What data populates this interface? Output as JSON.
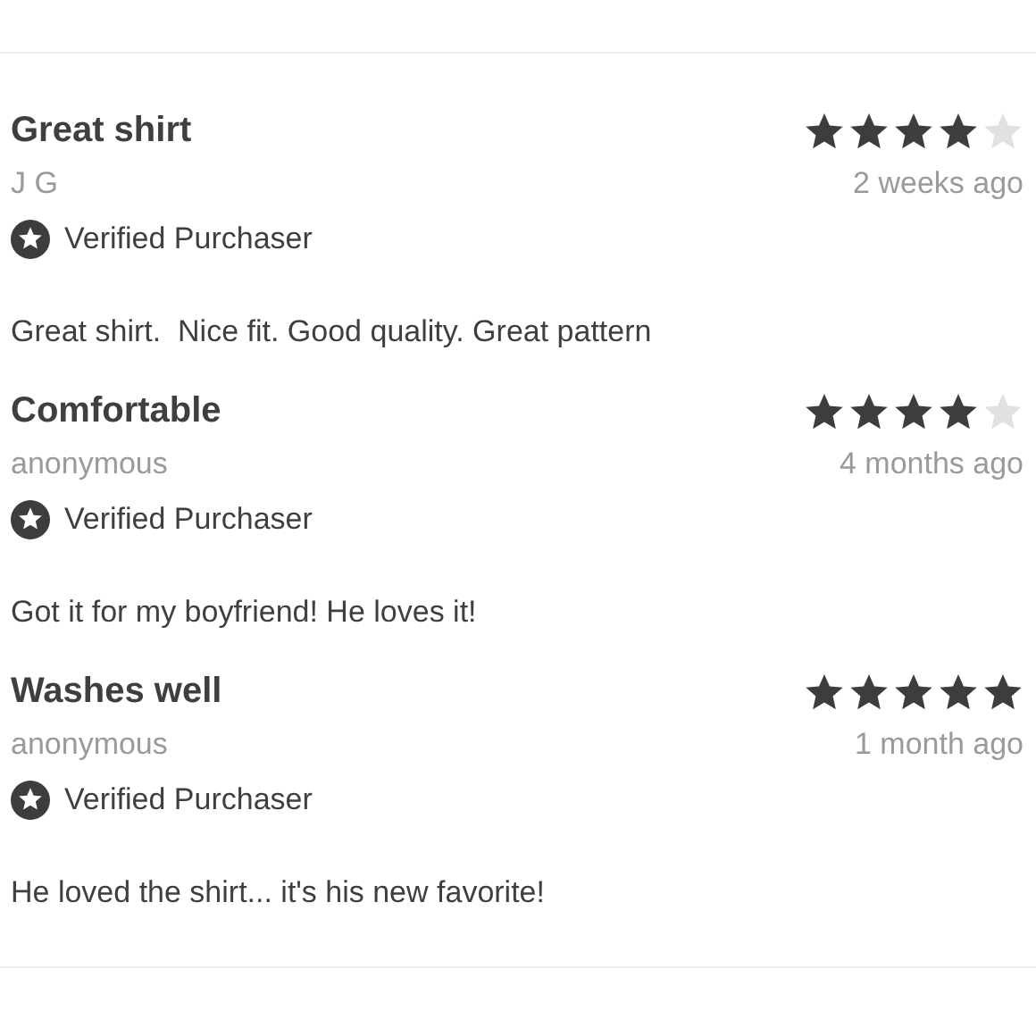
{
  "reviews": [
    {
      "title": "Great shirt",
      "author": "J G",
      "stars": 4,
      "time": "2 weeks ago",
      "verified": true,
      "verified_label": "Verified Purchaser",
      "body": "Great shirt.  Nice fit. Good quality. Great pattern"
    },
    {
      "title": "Comfortable",
      "author": "anonymous",
      "stars": 4,
      "time": "4 months ago",
      "verified": true,
      "verified_label": "Verified Purchaser",
      "body": "Got it for my boyfriend! He loves it!"
    },
    {
      "title": "Washes well",
      "author": "anonymous",
      "stars": 5,
      "time": "1 month ago",
      "verified": true,
      "verified_label": "Verified Purchaser",
      "body": "He loved the shirt... it's his new favorite!"
    }
  ]
}
